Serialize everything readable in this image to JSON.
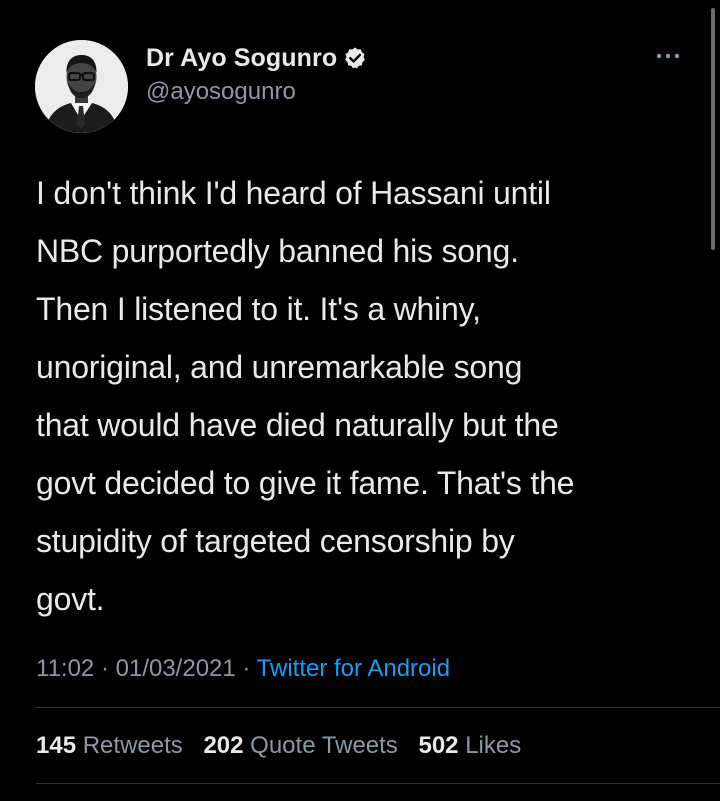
{
  "author": {
    "name": "Dr Ayo Sogunro",
    "handle": "@ayosogunro",
    "verified": true
  },
  "tweet": {
    "lines": [
      "I don't think I'd heard of Hassani until",
      "NBC purportedly banned his song.",
      "Then I listened to it. It's a whiny,",
      "unoriginal, and unremarkable song",
      "that would have died naturally but the",
      "govt decided to give it fame. That's the",
      "stupidity of targeted censorship by",
      "govt."
    ]
  },
  "meta": {
    "time": "11:02",
    "separator": "·",
    "date": "01/03/2021",
    "source": "Twitter for Android"
  },
  "stats": {
    "retweets": {
      "count": "145",
      "label": "Retweets"
    },
    "quotes": {
      "count": "202",
      "label": "Quote Tweets"
    },
    "likes": {
      "count": "502",
      "label": "Likes"
    }
  },
  "colors": {
    "background": "#000000",
    "text": "#e7e9ea",
    "secondary": "#8b98a5",
    "link": "#1d9bf0",
    "divider": "#2f3336"
  },
  "icons": {
    "verified": "verified-badge-icon",
    "more": "more-options-icon"
  }
}
